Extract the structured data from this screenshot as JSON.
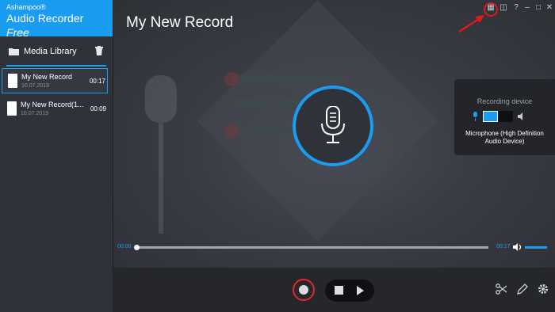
{
  "brand": {
    "company": "Ashampoo®",
    "product_prefix": "Audio Recorder ",
    "product_suffix": "Free"
  },
  "sidebar": {
    "library_label": "Media Library",
    "records": [
      {
        "name": "My New Record",
        "date": "10.07.2019",
        "duration": "00:17",
        "selected": true
      },
      {
        "name": "My New Record(1...",
        "date": "10.07.2019",
        "duration": "00:09",
        "selected": false
      }
    ]
  },
  "main": {
    "title": "My New Record"
  },
  "window_controls": {
    "help": "?"
  },
  "device": {
    "heading": "Recording device",
    "name": "Microphone (High Definition Audio Device)"
  },
  "timeline": {
    "current": "00:00",
    "total": "00:17",
    "progress": 0.0
  },
  "colors": {
    "accent": "#1a9cf0",
    "record": "#e02828"
  }
}
